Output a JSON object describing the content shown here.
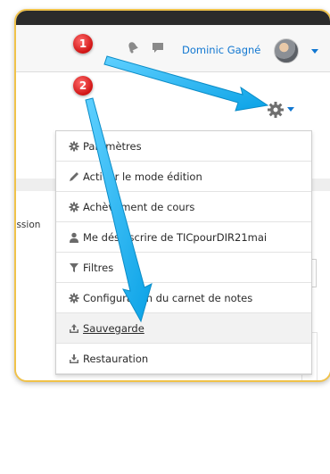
{
  "navbar": {
    "user_name": "Dominic Gagné"
  },
  "badges": {
    "one": "1",
    "two": "2"
  },
  "background": {
    "session_text": "ession"
  },
  "menu": {
    "items": [
      {
        "label": "Paramètres",
        "icon": "gear-icon"
      },
      {
        "label": "Activer le mode édition",
        "icon": "pencil-icon"
      },
      {
        "label": "Achèvement de cours",
        "icon": "gear-icon"
      },
      {
        "label": "Me désinscrire de TICpourDIR21mai",
        "icon": "user-icon"
      },
      {
        "label": "Filtres",
        "icon": "filter-icon"
      },
      {
        "label": "Configuration du carnet de notes",
        "icon": "gear-icon"
      },
      {
        "label": "Sauvegarde",
        "icon": "upload-icon"
      },
      {
        "label": "Restauration",
        "icon": "download-icon"
      }
    ]
  },
  "colors": {
    "accent": "#1177d1",
    "frame_border": "#f0c24a",
    "badge_red": "#d01313",
    "arrow_blue": "#19b4f0"
  }
}
